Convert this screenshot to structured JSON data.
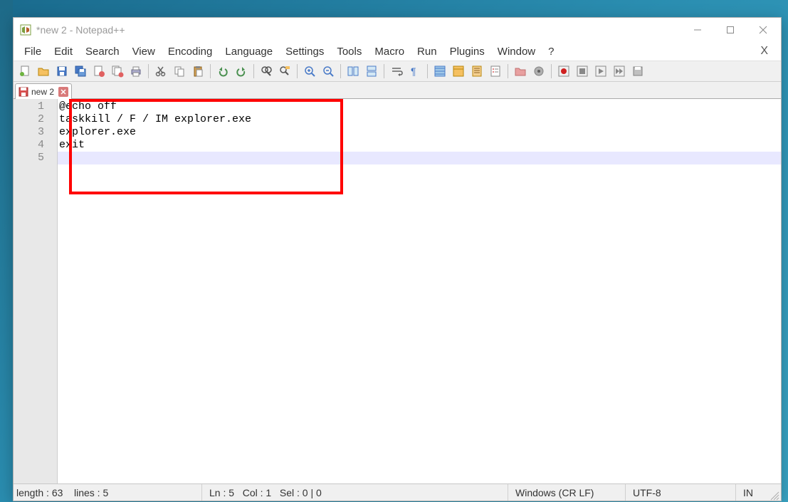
{
  "window": {
    "title": "*new 2 - Notepad++"
  },
  "menu": {
    "items": [
      "File",
      "Edit",
      "Search",
      "View",
      "Encoding",
      "Language",
      "Settings",
      "Tools",
      "Macro",
      "Run",
      "Plugins",
      "Window",
      "?"
    ],
    "close": "X"
  },
  "tabs": [
    {
      "label": "new 2"
    }
  ],
  "editor": {
    "lines": [
      "@echo off",
      "taskkill / F / IM explorer.exe",
      "explorer.exe",
      "exit",
      ""
    ],
    "current_line_index": 4
  },
  "status": {
    "length_label": "length :",
    "length_value": "63",
    "lines_label": "lines :",
    "lines_value": "5",
    "ln_label": "Ln :",
    "ln_value": "5",
    "col_label": "Col :",
    "col_value": "1",
    "sel_label": "Sel :",
    "sel_value": "0 | 0",
    "eol": "Windows (CR LF)",
    "encoding": "UTF-8",
    "mode": "IN"
  }
}
